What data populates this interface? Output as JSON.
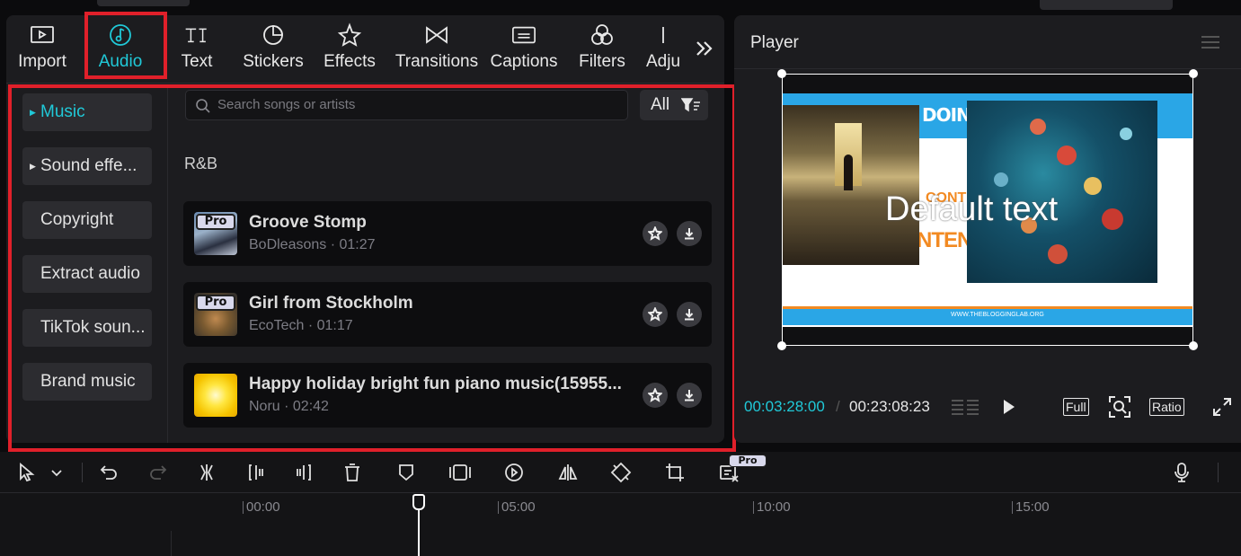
{
  "toolbar": {
    "tabs": [
      {
        "label": "Import",
        "icon": "import-icon"
      },
      {
        "label": "Audio",
        "icon": "audio-note-icon",
        "active": true
      },
      {
        "label": "Text",
        "icon": "text-icon"
      },
      {
        "label": "Stickers",
        "icon": "sticker-icon"
      },
      {
        "label": "Effects",
        "icon": "sparkle-star-icon"
      },
      {
        "label": "Transitions",
        "icon": "bowtie-icon"
      },
      {
        "label": "Captions",
        "icon": "captions-icon"
      },
      {
        "label": "Filters",
        "icon": "filters-icon"
      },
      {
        "label": "Adju",
        "icon": "adjust-icon"
      }
    ],
    "more_icon": "double-chevron-right-icon"
  },
  "sidebar": {
    "items": [
      {
        "label": "Music",
        "active": true,
        "expandable": true
      },
      {
        "label": "Sound effe...",
        "expandable": true
      },
      {
        "label": "Copyright"
      },
      {
        "label": "Extract audio"
      },
      {
        "label": "TikTok soun..."
      },
      {
        "label": "Brand music"
      }
    ]
  },
  "search": {
    "placeholder": "Search songs or artists"
  },
  "filter": {
    "label": "All"
  },
  "category": "R&B",
  "tracks": [
    {
      "title": "Groove Stomp",
      "meta": "BoDleasons · 01:27",
      "pro": "Pro"
    },
    {
      "title": "Girl from Stockholm",
      "meta": "EcoTech · 01:17",
      "pro": "Pro"
    },
    {
      "title": "Happy holiday bright fun piano music(15955...",
      "meta": "Noru · 02:42",
      "pro": ""
    }
  ],
  "player": {
    "title": "Player",
    "current_time": "00:03:28:00",
    "separator": "/",
    "total_time": "00:23:08:23",
    "full_label": "Full",
    "ratio_label": "Ratio",
    "slide_heading": "DOING",
    "slide_word1": "CONTE",
    "slide_word2": "NTEN",
    "slide_url": "WWW.THEBLOGGINGLAB.ORG",
    "overlay_text": "Default text"
  },
  "timeline": {
    "ticks": [
      "00:00",
      "05:00",
      "10:00",
      "15:00"
    ],
    "pro_badge": "Pro"
  },
  "colors": {
    "accent": "#20c9d8",
    "highlight": "#e0202a",
    "panel": "#1c1c1f"
  }
}
